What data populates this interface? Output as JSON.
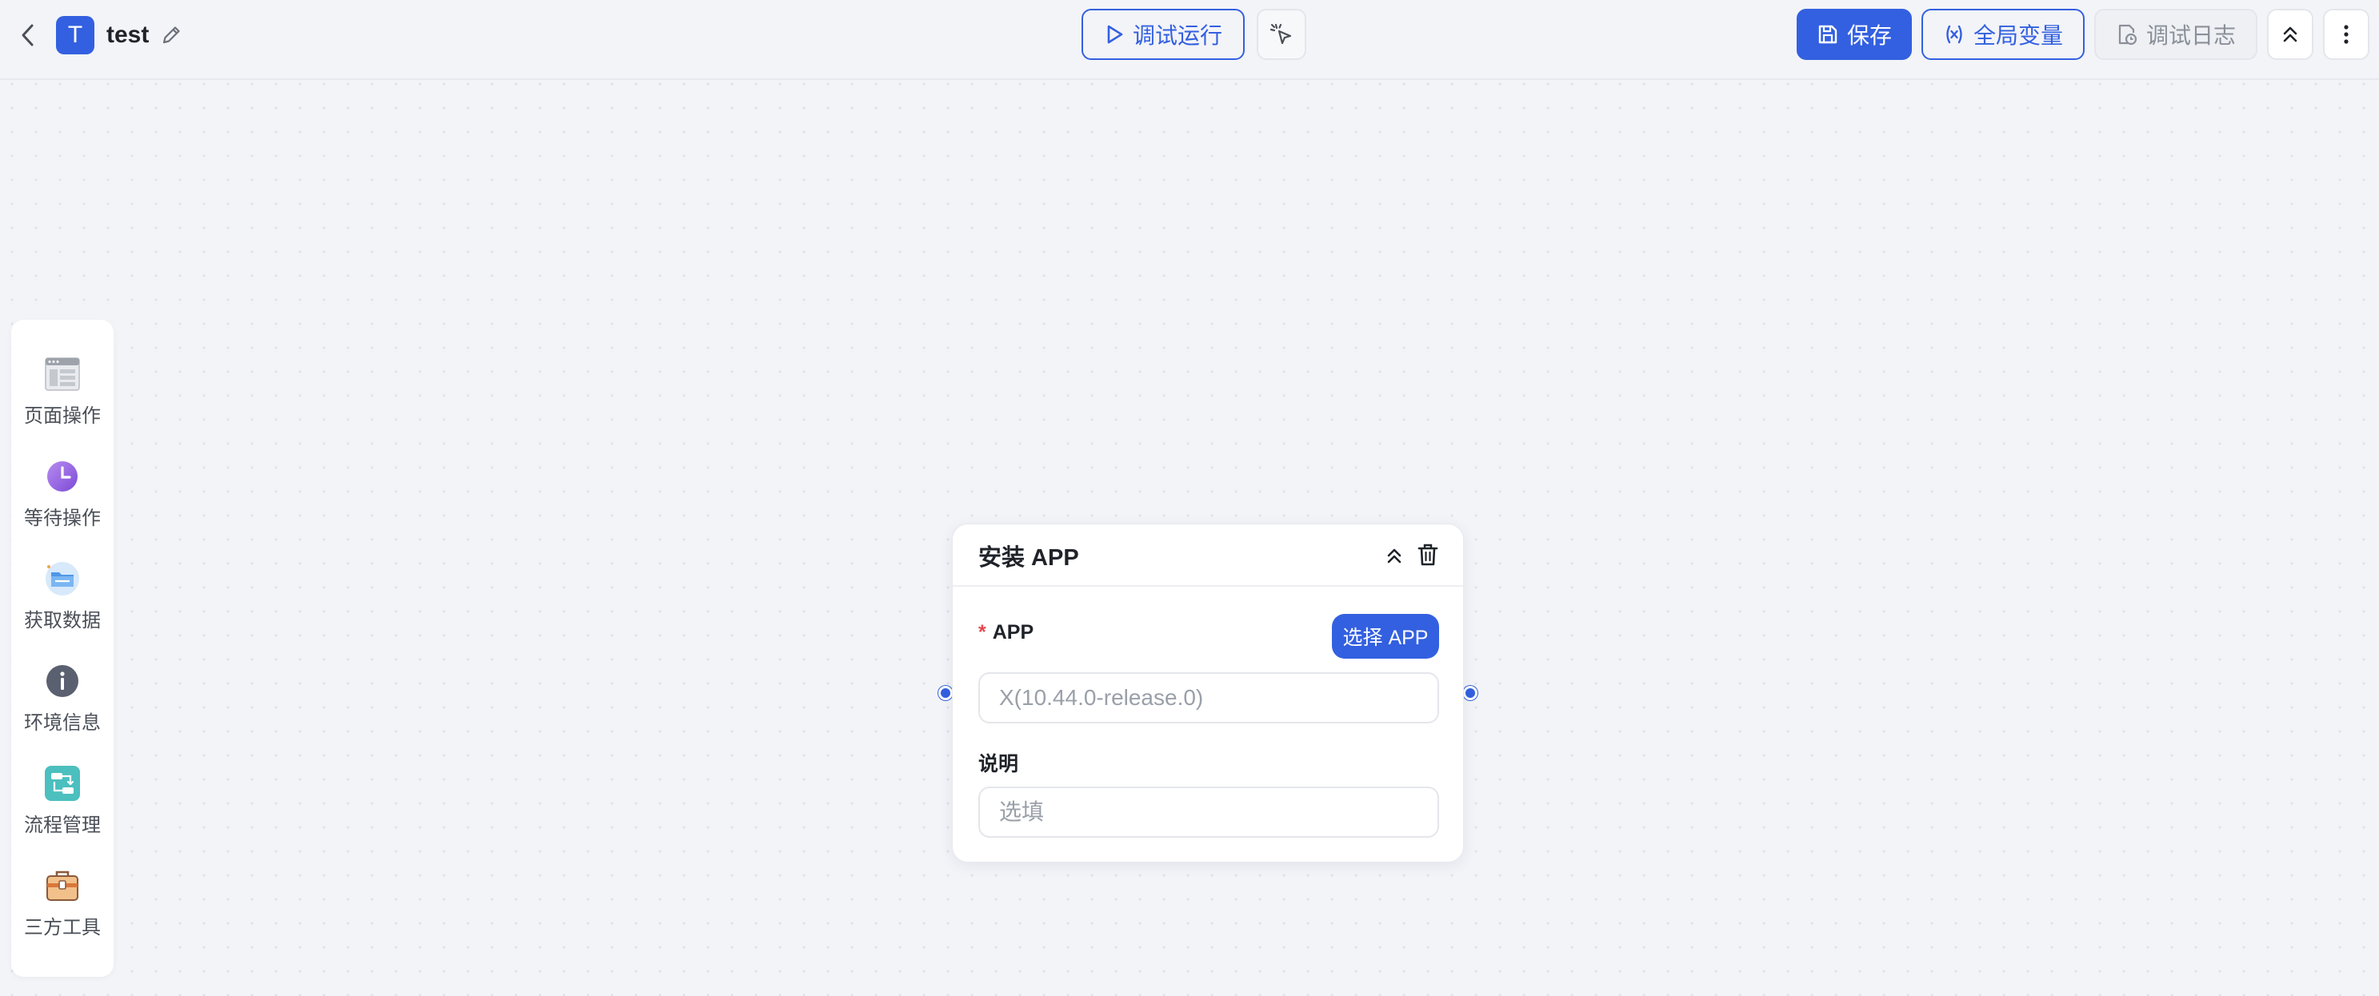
{
  "header": {
    "title": "test",
    "avatar_letter": "T",
    "debug_run_label": "调试运行",
    "save_label": "保存",
    "global_vars_label": "全局变量",
    "debug_log_label": "调试日志",
    "icons": {
      "back": "chevron-left-icon",
      "edit": "pencil-icon",
      "debug_run": "play-icon",
      "cursor": "pointer-click-icon",
      "save": "save-icon",
      "global_vars": "variable-icon",
      "debug_log": "log-file-icon",
      "collapse": "double-chevron-up-icon",
      "more": "vertical-dots-icon"
    }
  },
  "sidebar": {
    "items": [
      {
        "label": "页面操作",
        "icon": "browser-page-icon"
      },
      {
        "label": "等待操作",
        "icon": "clock-icon"
      },
      {
        "label": "获取数据",
        "icon": "folder-data-icon"
      },
      {
        "label": "环境信息",
        "icon": "info-icon"
      },
      {
        "label": "流程管理",
        "icon": "flow-icon"
      },
      {
        "label": "三方工具",
        "icon": "toolbox-icon"
      }
    ]
  },
  "node": {
    "title": "安装 APP",
    "app_field_label": "APP",
    "required_mark": "*",
    "select_app_label": "选择 APP",
    "app_placeholder": "X(10.44.0-release.0)",
    "desc_label": "说明",
    "desc_placeholder": "选填"
  },
  "colors": {
    "accent": "#3360e0",
    "background": "#f3f4f8",
    "required": "#e5484d"
  }
}
